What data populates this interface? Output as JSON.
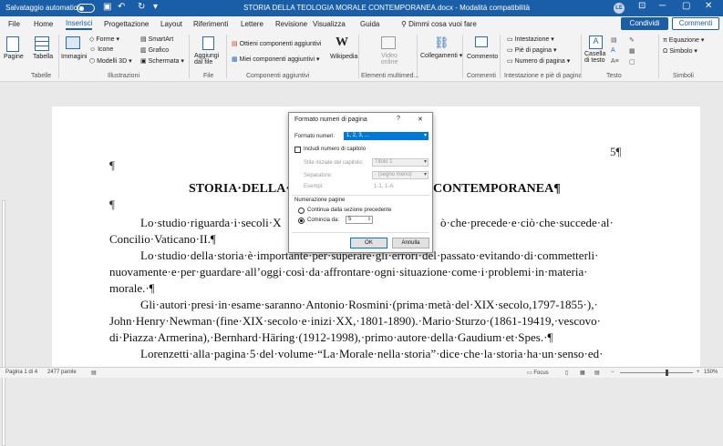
{
  "titlebar": {
    "autosave_label": "Salvataggio automatico",
    "doc_title": "STORIA DELLA TEOLOGIA MORALE CONTEMPORANEA.docx - Modalità compatibilità",
    "user_initials": "LE"
  },
  "tabs": [
    "File",
    "Home",
    "Inserisci",
    "Progettazione",
    "Layout",
    "Riferimenti",
    "Lettere",
    "Revisione",
    "Visualizza",
    "Guida",
    "Dimmi cosa vuoi fare"
  ],
  "share_label": "Condividi",
  "comments_label": "Commenti",
  "ribbon": {
    "pages": "Pagine",
    "table": "Tabella",
    "tables_group": "Tabelle",
    "images": "Immagini",
    "shapes": "Forme",
    "icons": "Icone",
    "models3d": "Modelli 3D",
    "smartart": "SmartArt",
    "chart": "Grafico",
    "screenshot": "Schermata",
    "illustrations_group": "Illustrazioni",
    "addin": "Aggiungi dal file",
    "files_group": "File",
    "get_addins": "Ottieni componenti aggiuntivi",
    "my_addins": "Miei componenti aggiuntivi",
    "addins_group": "Componenti aggiuntivi",
    "wikipedia": "Wikipedia",
    "online_video": "Video online",
    "media_group": "Elementi multimed...",
    "links": "Collegamenti",
    "comment": "Commento",
    "comments_group": "Commenti",
    "header": "Intestazione",
    "footer": "Piè di pagina",
    "page_number": "Numero di pagina",
    "hf_group": "Intestazione e piè di pagina",
    "textbox": "Casella di testo",
    "text_group": "Testo",
    "equation": "Equazione",
    "symbol": "Simbolo",
    "symbols_group": "Simboli"
  },
  "document": {
    "top_mark": "¶",
    "page_num": "5¶",
    "heading_left": "STORIA·DELLA·T",
    "heading_right": "CONTEMPORANEA¶",
    "empty_mark": "¶",
    "lines": [
      "Lo·studio·riguarda·i·secoli·X",
      "ò·che·precede·e·ciò·che·succede·al·",
      "Concilio·Vaticano·II.¶",
      "Lo·studio·della·storia·è·importante·per·superare·gli·errori·del·passato·evitando·di·commetterli·",
      "nuovamente·e·per·guardare·all’oggi·così·da·affrontare·ogni·situazione·come·i·problemi·in·materia·",
      "morale.·¶",
      "Gli·autori·presi·in·esame·saranno·Antonio·Rosmini·(prima·metà·del·XIX·secolo,1797-1855·),·",
      "John·Henry·Newman·(fine·XIX·secolo·e·inizi·XX,·1801-1890).·Mario·Sturzo·(1861-19419,·vescovo·",
      "di·Piazza·Armerina),·Bernhard·Häring·(1912-1998),·primo·autore·della·Gaudium·et·Spes.·¶",
      "Lorenzetti·alla·pagina·5·del·volume·“La·Morale·nella·storia”·dice·che·la·storia·ha·un·senso·ed·"
    ]
  },
  "dialog": {
    "title": "Formato numeri di pagina",
    "help": "?",
    "close": "✕",
    "format_label": "Formato numeri:",
    "format_value": "1, 2, 3, ...",
    "include_chapter": "Includi numero di capitolo",
    "chapter_style_label": "Stile iniziale del capitolo:",
    "chapter_style_value": "Titolo 1",
    "separator_label": "Separatore:",
    "separator_value": "-   (segno meno)",
    "examples_label": "Esempi:",
    "examples_value": "1-1, 1-A",
    "numbering_title": "Numerazione pagine",
    "continue_label": "Continua dalla sezione precedente",
    "start_label": "Comincia da:",
    "start_value": "5",
    "ok": "OK",
    "cancel": "Annulla"
  },
  "status": {
    "page": "Pagina 1 di 4",
    "words": "2477 parole",
    "focus": "Focus",
    "zoom": "150%"
  }
}
